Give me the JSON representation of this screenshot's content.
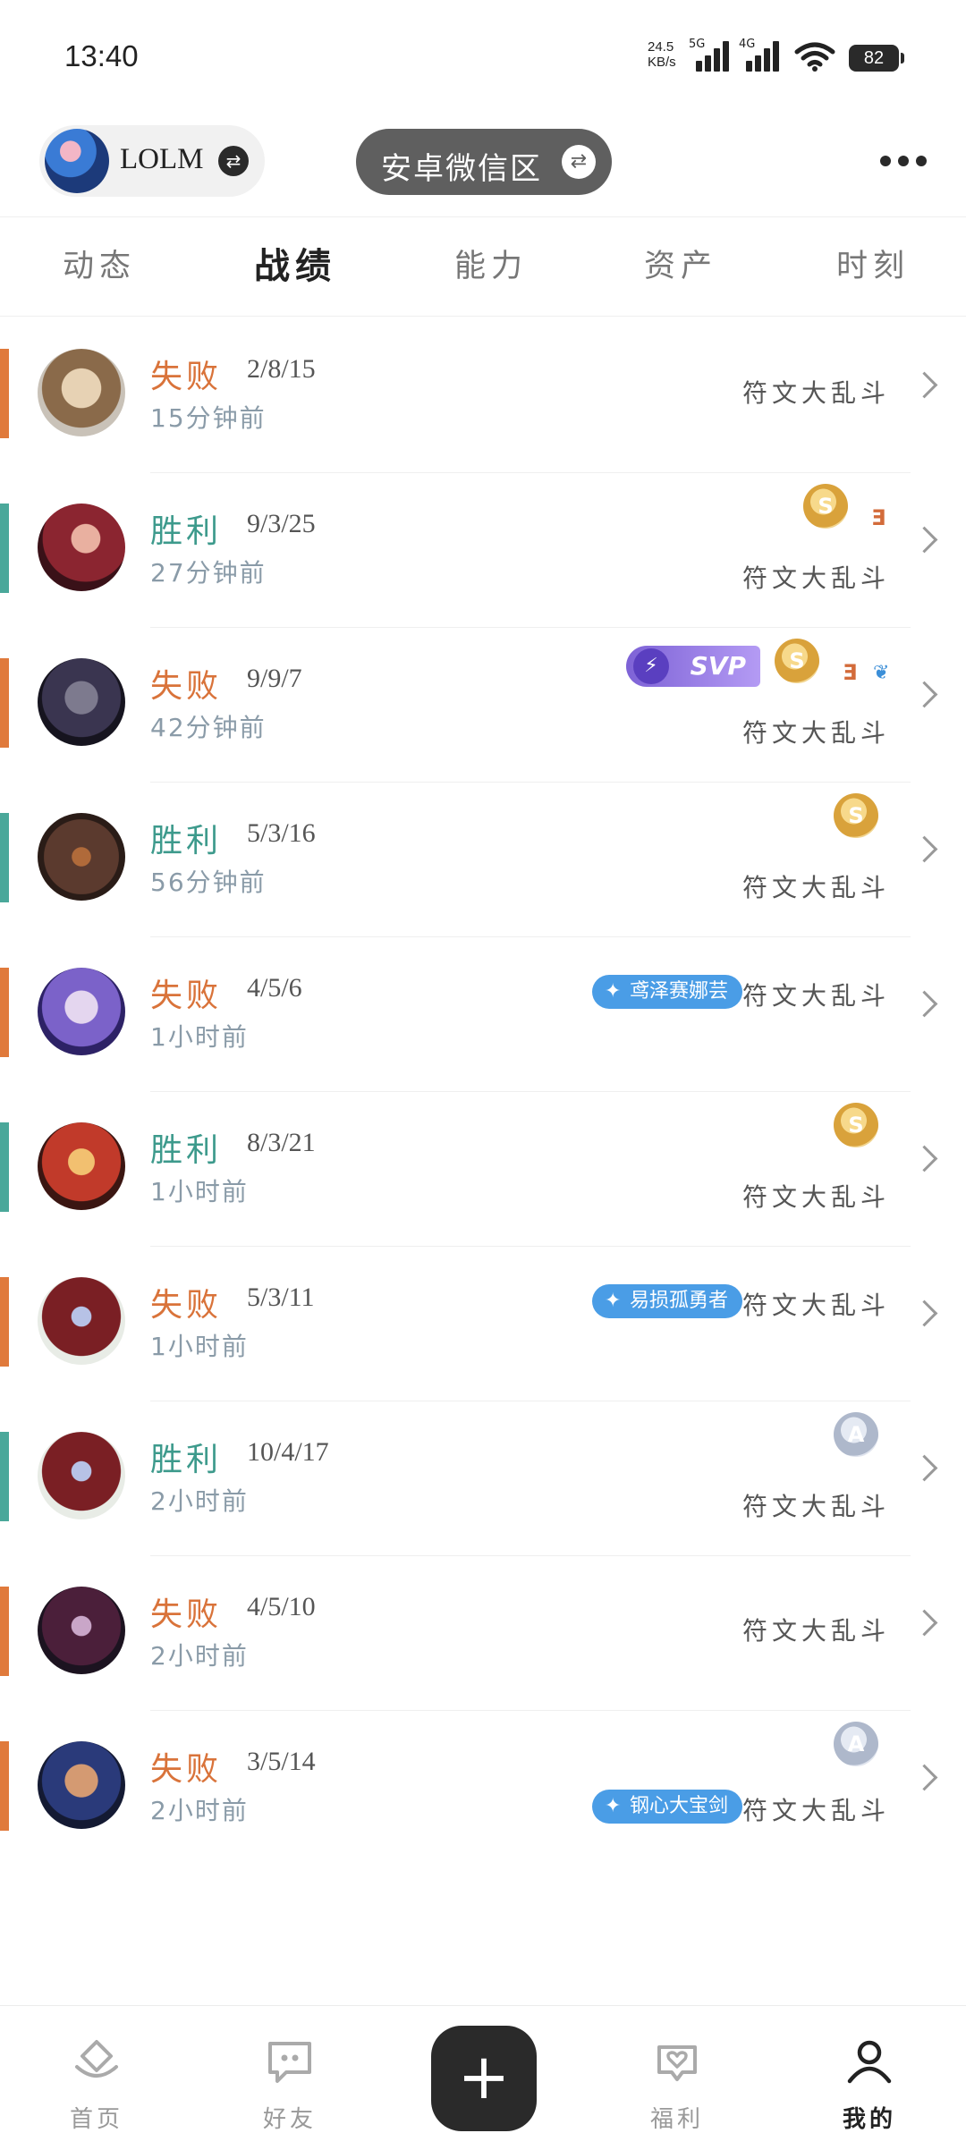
{
  "status": {
    "time": "13:40",
    "speed": "24.5",
    "speed_unit": "KB/s",
    "sig1": "5G",
    "sig2": "4G",
    "battery": "82"
  },
  "header": {
    "account_name": "LOLM",
    "server": "安卓微信区",
    "swap_glyph": "⇄"
  },
  "tabs": [
    {
      "label": "动态",
      "active": false
    },
    {
      "label": "战绩",
      "active": true
    },
    {
      "label": "能力",
      "active": false
    },
    {
      "label": "资产",
      "active": false
    },
    {
      "label": "时刻",
      "active": false
    }
  ],
  "matches": [
    {
      "result": "失败",
      "kda": "2/8/15",
      "ago": "15分钟前",
      "mode": "符文大乱斗"
    },
    {
      "result": "胜利",
      "kda": "9/3/25",
      "ago": "27分钟前",
      "mode": "符文大乱斗",
      "medal": "S",
      "extra": "Ǝ"
    },
    {
      "result": "失败",
      "kda": "9/9/7",
      "ago": "42分钟前",
      "mode": "符文大乱斗",
      "svp": "SVP",
      "medal": "S",
      "extra": "Ǝ"
    },
    {
      "result": "胜利",
      "kda": "5/3/16",
      "ago": "56分钟前",
      "mode": "符文大乱斗",
      "medal": "S"
    },
    {
      "result": "失败",
      "kda": "4/5/6",
      "ago": "1小时前",
      "mode": "符文大乱斗",
      "tag": "鸢泽赛娜芸"
    },
    {
      "result": "胜利",
      "kda": "8/3/21",
      "ago": "1小时前",
      "mode": "符文大乱斗",
      "medal": "S"
    },
    {
      "result": "失败",
      "kda": "5/3/11",
      "ago": "1小时前",
      "mode": "符文大乱斗",
      "tag": "易损孤勇者"
    },
    {
      "result": "胜利",
      "kda": "10/4/17",
      "ago": "2小时前",
      "mode": "符文大乱斗",
      "medal": "A"
    },
    {
      "result": "失败",
      "kda": "4/5/10",
      "ago": "2小时前",
      "mode": "符文大乱斗"
    },
    {
      "result": "失败",
      "kda": "3/5/14",
      "ago": "2小时前",
      "mode": "符文大乱斗",
      "medal": "A",
      "tag": "钢心大宝剑"
    }
  ],
  "nav": [
    {
      "label": "首页",
      "icon": "home-icon"
    },
    {
      "label": "好友",
      "icon": "chat-icon"
    },
    {
      "label": "+",
      "icon": "plus-icon"
    },
    {
      "label": "福利",
      "icon": "gift-heart-icon"
    },
    {
      "label": "我的",
      "icon": "profile-icon"
    }
  ],
  "colors": {
    "lose": "#d9733a",
    "win": "#3d9a8c",
    "lose_bar": "#e07a3c",
    "win_bar": "#4aa89a"
  }
}
